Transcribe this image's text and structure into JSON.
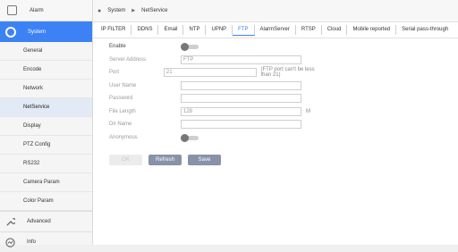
{
  "sidebar": {
    "alarm": "Alarm",
    "system": "System",
    "items": [
      "General",
      "Encode",
      "Network",
      "NetService",
      "Display",
      "PTZ Config",
      "RS232",
      "Camera Param",
      "Color Param"
    ],
    "advanced": "Advanced",
    "info": "Info"
  },
  "breadcrumb": {
    "root": "System",
    "current": "NetService"
  },
  "tabs": [
    "IP FILTER",
    "DDNS",
    "Email",
    "NTP",
    "UPNP",
    "FTP",
    "AlarmServer",
    "RTSP",
    "Cloud",
    "Mobile reported",
    "Serial pass-through"
  ],
  "form": {
    "enable_label": "Enable",
    "server_address_label": "Server Address",
    "server_address_value": "FTP",
    "port_label": "Port",
    "port_value": "21",
    "port_hint": "(FTP port can't be less than 21)",
    "username_label": "User Name",
    "username_value": "",
    "password_label": "Password",
    "password_value": "",
    "file_length_label": "File Length",
    "file_length_value": "128",
    "file_length_unit": "M",
    "dir_name_label": "Dir Name",
    "dir_name_value": "",
    "anonymous_label": "Anonymous"
  },
  "buttons": {
    "ok": "OK",
    "refresh": "Refresh",
    "save": "Save"
  },
  "colors": {
    "accent": "#3c82f5",
    "button": "#8892a8"
  }
}
